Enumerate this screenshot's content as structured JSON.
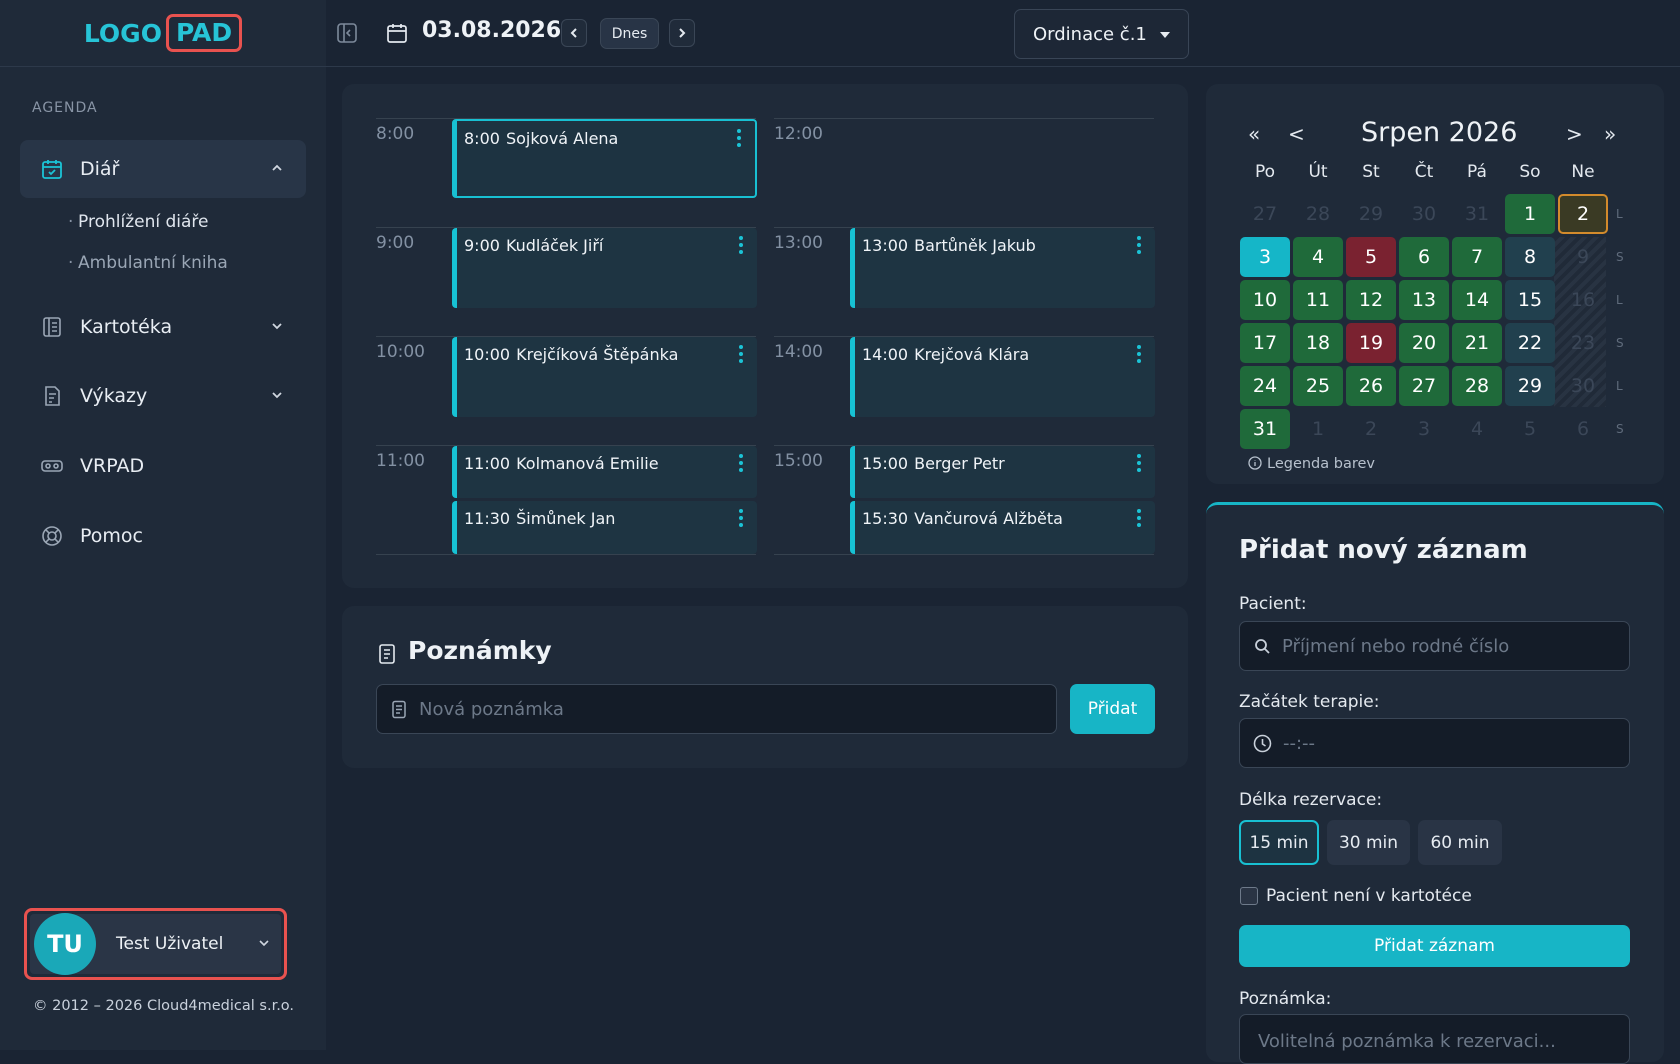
{
  "logo": {
    "part1": "LOGO",
    "part2": "PAD"
  },
  "sidebar": {
    "section": "AGENDA",
    "items": [
      {
        "label": "Diář",
        "icon": "calendar-check-icon"
      },
      {
        "label": "Kartotéka",
        "icon": "card-index-icon"
      },
      {
        "label": "Výkazy",
        "icon": "report-icon"
      },
      {
        "label": "VRPAD",
        "icon": "vr-goggles-icon"
      },
      {
        "label": "Pomoc",
        "icon": "lifebuoy-icon"
      }
    ],
    "subitems": [
      "Prohlížení diáře",
      "Ambulantní kniha"
    ]
  },
  "user": {
    "initials": "TU",
    "name": "Test Uživatel"
  },
  "footer": {
    "copyright": "© 2012 – 2026 Cloud4medical s.r.o."
  },
  "topbar": {
    "date": "03.08.2026",
    "today_label": "Dnes",
    "office": "Ordinace č.1"
  },
  "schedule": {
    "left_hours": [
      "8:00",
      "9:00",
      "10:00",
      "11:00"
    ],
    "right_hours": [
      "12:00",
      "13:00",
      "14:00",
      "15:00"
    ],
    "appointments": [
      {
        "time": "8:00",
        "name": "Sojková Alena"
      },
      {
        "time": "9:00",
        "name": "Kudláček Jiří"
      },
      {
        "time": "10:00",
        "name": "Krejčíková Štěpánka"
      },
      {
        "time": "11:00",
        "name": "Kolmanová Emilie"
      },
      {
        "time": "11:30",
        "name": "Šimůnek Jan"
      },
      {
        "time": "13:00",
        "name": "Bartůněk Jakub"
      },
      {
        "time": "14:00",
        "name": "Krejčová Klára"
      },
      {
        "time": "15:00",
        "name": "Berger Petr"
      },
      {
        "time": "15:30",
        "name": "Vančurová Alžběta"
      }
    ]
  },
  "notes": {
    "title": "Poznámky",
    "placeholder": "Nová poznámka",
    "add": "Přidat"
  },
  "calendar": {
    "month": "Srpen 2026",
    "nav": {
      "prev_year": "«",
      "prev": "<",
      "next": ">",
      "next_year": "»"
    },
    "weekdays": [
      "Po",
      "Út",
      "St",
      "Čt",
      "Pá",
      "So",
      "Ne"
    ],
    "weeks": [
      [
        "27",
        "28",
        "29",
        "30",
        "31",
        "1",
        "2"
      ],
      [
        "3",
        "4",
        "5",
        "6",
        "7",
        "8",
        "9"
      ],
      [
        "10",
        "11",
        "12",
        "13",
        "14",
        "15",
        "16"
      ],
      [
        "17",
        "18",
        "19",
        "20",
        "21",
        "22",
        "23"
      ],
      [
        "24",
        "25",
        "26",
        "27",
        "28",
        "29",
        "30"
      ],
      [
        "31",
        "1",
        "2",
        "3",
        "4",
        "5",
        "6"
      ]
    ],
    "week_marks": [
      "L",
      "S",
      "L",
      "S",
      "L",
      "S"
    ],
    "legend": "Legenda barev",
    "colors": {
      "green": "#1f6a3a",
      "red": "#7a2230",
      "teal": "#15b6c8",
      "blue": "#21404e",
      "today_border": "#d38b2c"
    }
  },
  "form": {
    "title": "Přidat nový záznam",
    "patient_label": "Pacient:",
    "patient_placeholder": "Příjmení nebo rodné číslo",
    "start_label": "Začátek terapie:",
    "start_placeholder": "--:--",
    "duration_label": "Délka rezervace:",
    "durations": [
      "15 min",
      "30 min",
      "60 min"
    ],
    "not_in_registry": "Pacient není v kartotéce",
    "submit": "Přidat záznam",
    "note_label": "Poznámka:",
    "note_placeholder": "Volitelná poznámka k rezervaci..."
  },
  "accent": "#17b5c6"
}
